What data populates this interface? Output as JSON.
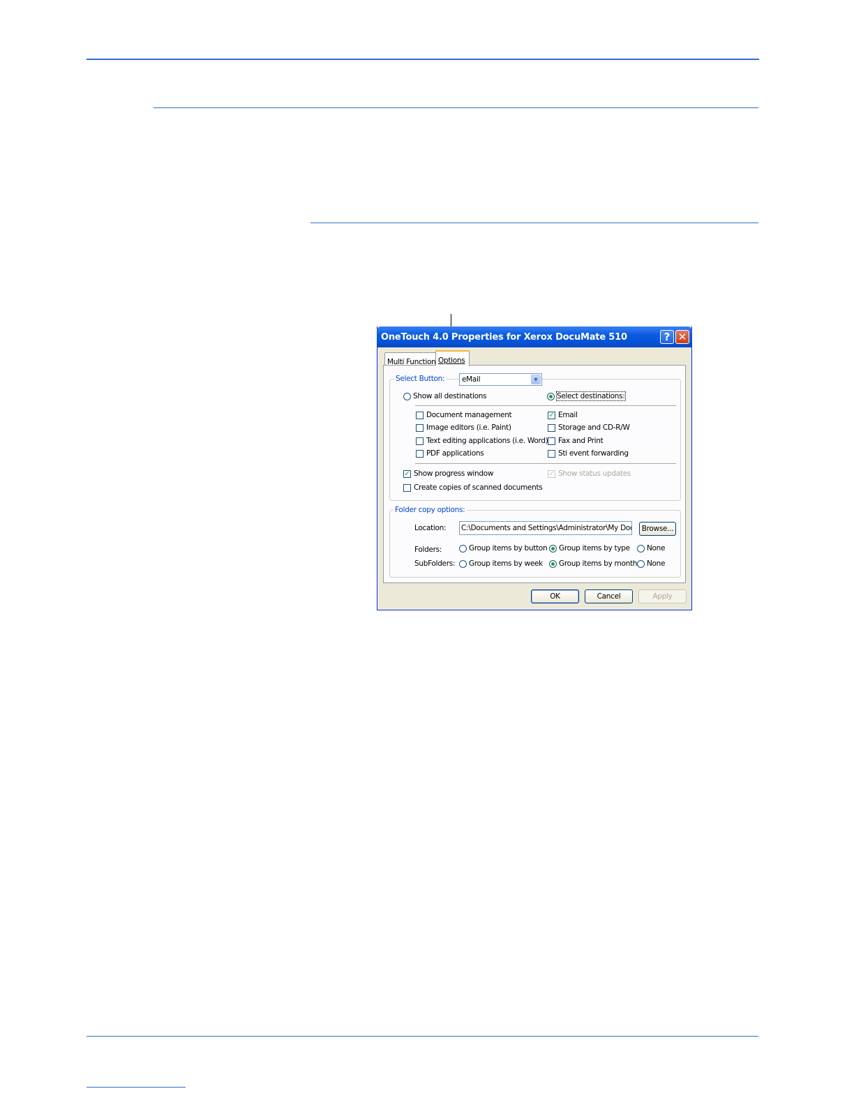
{
  "dialog": {
    "title": "OneTouch 4.0 Properties for Xerox DocuMate 510",
    "help_button": "?",
    "close_button": "✕",
    "tabs": [
      {
        "label": "Multi Function",
        "active": false
      },
      {
        "label": "Options",
        "active": true
      }
    ],
    "select_button": {
      "label": "Select Button:",
      "value": "eMail"
    },
    "destinations": {
      "show_all_label": "Show all destinations",
      "show_all_selected": false,
      "select_label": "Select destinations:",
      "select_selected": true
    },
    "checkboxes_left": [
      {
        "label": "Document management",
        "checked": false
      },
      {
        "label": "Image editors (i.e. Paint)",
        "checked": false
      },
      {
        "label": "Text editing applications (i.e. Word)",
        "checked": false
      },
      {
        "label": "PDF applications",
        "checked": false
      }
    ],
    "checkboxes_right": [
      {
        "label": "Email",
        "checked": true
      },
      {
        "label": "Storage and CD-R/W",
        "checked": false
      },
      {
        "label": "Fax and Print",
        "checked": false
      },
      {
        "label": "Sti event forwarding",
        "checked": false
      }
    ],
    "show_progress_window": {
      "label": "Show progress window",
      "checked": true
    },
    "show_status_updates": {
      "label": "Show status updates",
      "checked": true,
      "disabled": true
    },
    "create_copies": {
      "label": "Create copies of scanned documents",
      "checked": false
    },
    "folder_copy": {
      "legend": "Folder copy options:",
      "location_label": "Location:",
      "location_value": "C:\\Documents and Settings\\Administrator\\My Documents",
      "browse_label": "Browse...",
      "folders_label": "Folders:",
      "folders_options": [
        {
          "label": "Group items by button",
          "selected": false
        },
        {
          "label": "Group items by type",
          "selected": true
        },
        {
          "label": "None",
          "selected": false
        }
      ],
      "subfolders_label": "SubFolders:",
      "subfolders_options": [
        {
          "label": "Group items by week",
          "selected": false
        },
        {
          "label": "Group items by month",
          "selected": true
        },
        {
          "label": "None",
          "selected": false
        }
      ]
    },
    "buttons": {
      "ok": "OK",
      "cancel": "Cancel",
      "apply": "Apply"
    }
  },
  "colors": {
    "rule": "#2f6ecf",
    "titlebar": "#0a5ae0",
    "dialog_face": "#ece9d8",
    "check_green": "#21a121"
  }
}
